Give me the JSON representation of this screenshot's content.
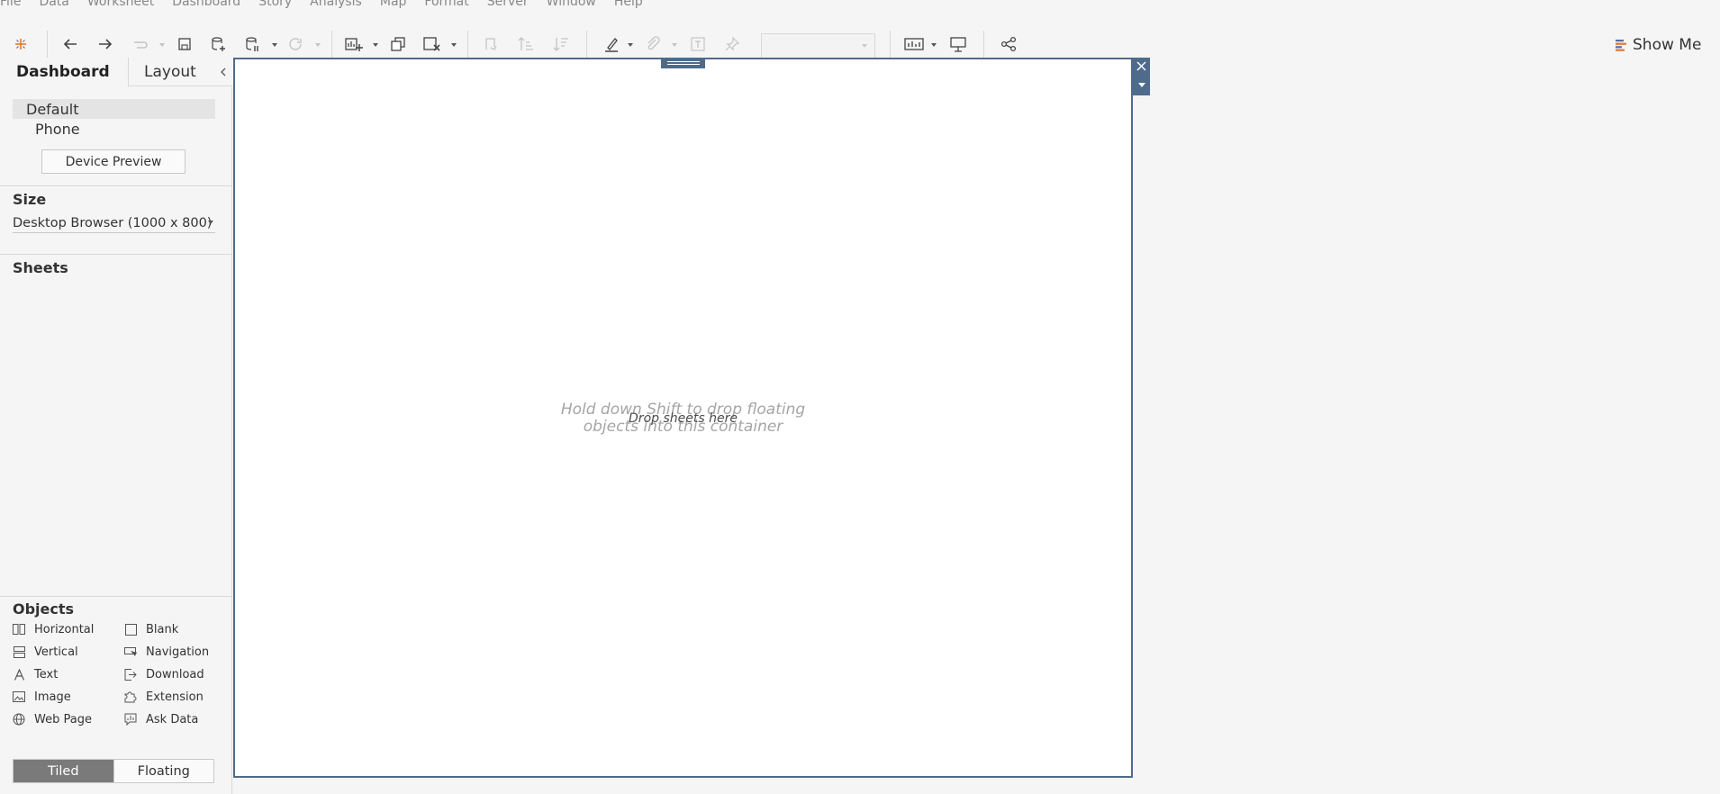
{
  "menu": [
    "File",
    "Data",
    "Worksheet",
    "Dashboard",
    "Story",
    "Analysis",
    "Map",
    "Format",
    "Server",
    "Window",
    "Help"
  ],
  "toolbar": {
    "show_me_label": "Show Me",
    "icons": [
      "tableau-logo-icon",
      "undo-icon",
      "redo-icon",
      "replay-icon",
      "save-icon",
      "new-data-source-icon",
      "pause-updates-icon",
      "refresh-icon",
      "new-worksheet-icon",
      "duplicate-icon",
      "clear-icon",
      "swap-icon",
      "sort-ascending-icon",
      "sort-descending-icon",
      "highlight-icon",
      "group-icon",
      "label-icon",
      "pin-icon",
      "fit-icon",
      "presentation-icon",
      "share-icon"
    ]
  },
  "tabs": {
    "dashboard": "Dashboard",
    "layout": "Layout"
  },
  "devices": {
    "default": "Default",
    "phone": "Phone",
    "preview_button": "Device Preview"
  },
  "size": {
    "title": "Size",
    "value": "Desktop Browser (1000 x 800)"
  },
  "sheets": {
    "title": "Sheets"
  },
  "objects": {
    "title": "Objects",
    "items": [
      {
        "label": "Horizontal",
        "icon": "horizontal-container-icon"
      },
      {
        "label": "Blank",
        "icon": "blank-icon"
      },
      {
        "label": "Vertical",
        "icon": "vertical-container-icon"
      },
      {
        "label": "Navigation",
        "icon": "navigation-icon"
      },
      {
        "label": "Text",
        "icon": "text-icon"
      },
      {
        "label": "Download",
        "icon": "download-icon"
      },
      {
        "label": "Image",
        "icon": "image-icon"
      },
      {
        "label": "Extension",
        "icon": "extension-icon"
      },
      {
        "label": "Web Page",
        "icon": "web-page-icon"
      },
      {
        "label": "Ask Data",
        "icon": "ask-data-icon"
      }
    ]
  },
  "layout_mode": {
    "tiled": "Tiled",
    "floating": "Floating",
    "selected": "Tiled"
  },
  "canvas": {
    "hint_line1": "Hold down Shift to drop floating",
    "hint_line2": "objects into this container",
    "drop_label": "Drop sheets here"
  },
  "colors": {
    "accent": "#4f6b8b",
    "tiled_selected": "#7a7a7a",
    "hint": "#a5a5a5"
  }
}
